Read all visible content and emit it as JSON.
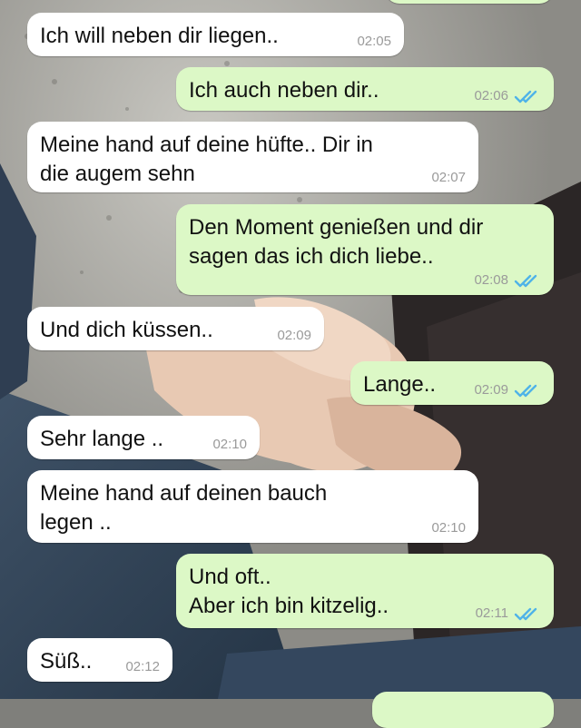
{
  "chat": {
    "messages": [
      {
        "dir": "in",
        "text": "Ich will neben dir liegen..",
        "time": "02:05"
      },
      {
        "dir": "out",
        "text": "Ich auch neben dir..",
        "time": "02:06",
        "read": true
      },
      {
        "dir": "in",
        "text": "Meine hand auf deine hüfte.. Dir in\ndie augem sehn",
        "time": "02:07"
      },
      {
        "dir": "out",
        "text": "Den Moment genießen und dir\nsagen das ich dich liebe..",
        "time": "02:08",
        "read": true
      },
      {
        "dir": "in",
        "text": "Und dich küssen..",
        "time": "02:09"
      },
      {
        "dir": "out",
        "text": "Lange..",
        "time": "02:09",
        "read": true
      },
      {
        "dir": "in",
        "text": "Sehr lange ..",
        "time": "02:10"
      },
      {
        "dir": "in",
        "text": "Meine hand auf deinen bauch\nlegen ..",
        "time": "02:10"
      },
      {
        "dir": "out",
        "text": "Und oft..\nAber ich bin kitzelig..",
        "time": "02:11",
        "read": true
      },
      {
        "dir": "in",
        "text": "Süß..",
        "time": "02:12"
      }
    ]
  },
  "colors": {
    "incoming_bubble": "#ffffff",
    "outgoing_bubble": "#dcf8c6",
    "read_ticks": "#4fb3e8",
    "timestamp": "#9a9a9a"
  },
  "icons": {
    "read_receipt": "double-check-icon"
  }
}
